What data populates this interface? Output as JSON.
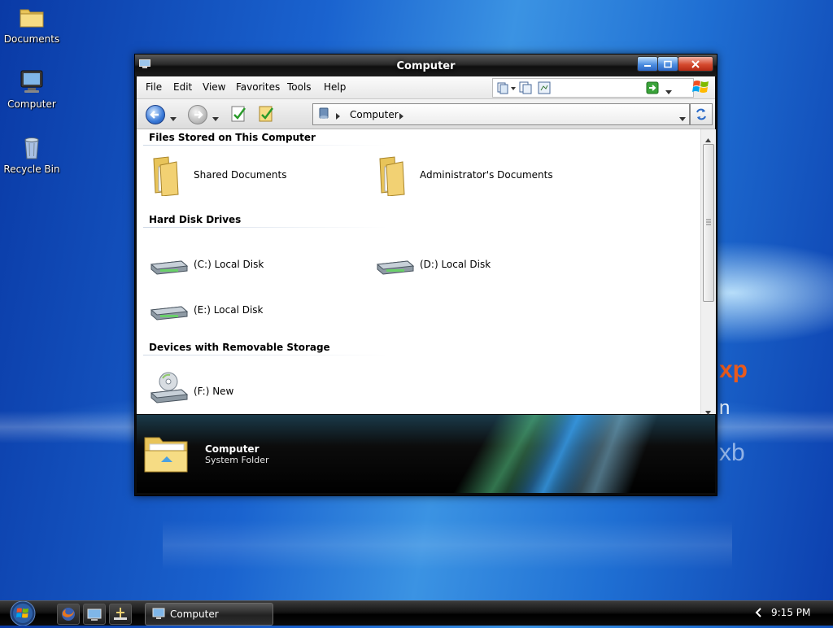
{
  "desktop": {
    "icons": [
      {
        "label": "Documents",
        "icon": "folder-icon"
      },
      {
        "label": "Computer",
        "icon": "monitor-icon"
      },
      {
        "label": "Recycle Bin",
        "icon": "recycle-bin-icon"
      }
    ],
    "wallpaper_text": {
      "xp": "xp",
      "n": "n",
      "xb": "xb"
    }
  },
  "window": {
    "title": "Computer",
    "menu": [
      "File",
      "Edit",
      "View",
      "Favorites",
      "Tools",
      "Help"
    ],
    "address": {
      "crumb": "Computer"
    },
    "groups": [
      {
        "header": "Files Stored on This Computer",
        "items": [
          {
            "label": "Shared Documents",
            "icon": "folder-icon"
          },
          {
            "label": "Administrator's Documents",
            "icon": "folder-icon"
          }
        ]
      },
      {
        "header": "Hard Disk Drives",
        "items": [
          {
            "label": "(C:) Local Disk",
            "icon": "hard-disk-icon"
          },
          {
            "label": "(D:) Local Disk",
            "icon": "hard-disk-icon"
          },
          {
            "label": "(E:) Local Disk",
            "icon": "hard-disk-icon"
          }
        ]
      },
      {
        "header": "Devices with Removable Storage",
        "items": [
          {
            "label": "(F:) New",
            "icon": "cd-drive-icon"
          }
        ]
      }
    ],
    "details": {
      "name": "Computer",
      "type": "System Folder"
    }
  },
  "taskbar": {
    "task_label": "Computer",
    "clock": "9:15 PM"
  },
  "colors": {
    "desktop_blue": "#1a63cf",
    "titlebar_dark": "#1c1c1c",
    "close_red": "#d54a2f"
  }
}
